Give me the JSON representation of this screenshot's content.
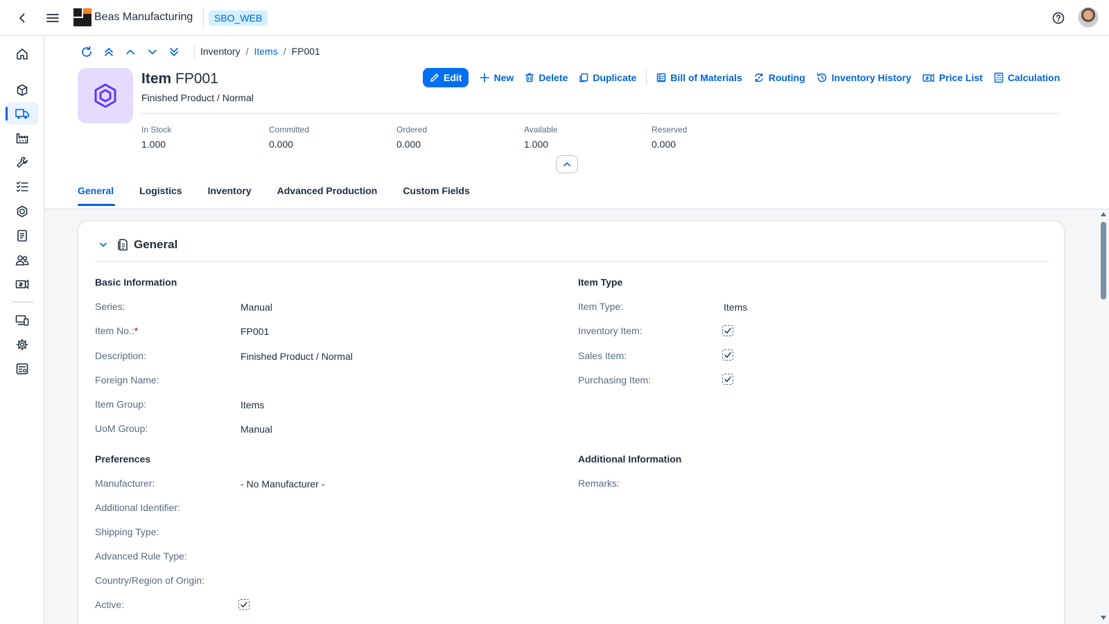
{
  "shell": {
    "brand": "Beas Manufacturing",
    "system": "SBO_WEB"
  },
  "sidenav": {
    "items": [
      "home-icon",
      "cubes-icon",
      "truck-icon",
      "factory-icon",
      "wrench-icon",
      "checklist-icon",
      "hexagon-icon",
      "document-icon",
      "people-icon",
      "pricing-icon",
      "device-icon",
      "gear-icon",
      "report-icon"
    ],
    "active": "truck-icon"
  },
  "breadcrumb": {
    "root": "Inventory",
    "parent": "Items",
    "current": "FP001",
    "separator": "/"
  },
  "header": {
    "title_bold": "Item",
    "title_id": "FP001",
    "subtitle": "Finished Product / Normal"
  },
  "actions": {
    "edit": "Edit",
    "new": "New",
    "delete": "Delete",
    "duplicate": "Duplicate",
    "bom": "Bill of Materials",
    "routing": "Routing",
    "inventory_history": "Inventory History",
    "price_list": "Price List",
    "calculation": "Calculation"
  },
  "kpis": [
    {
      "label": "In Stock",
      "value": "1.000"
    },
    {
      "label": "Committed",
      "value": "0.000"
    },
    {
      "label": "Ordered",
      "value": "0.000"
    },
    {
      "label": "Available",
      "value": "1.000"
    },
    {
      "label": "Reserved",
      "value": "0.000"
    }
  ],
  "tabs": [
    "General",
    "Logistics",
    "Inventory",
    "Advanced Production",
    "Custom Fields"
  ],
  "active_tab": "General",
  "section": {
    "title": "General",
    "basic": {
      "title": "Basic Information",
      "series_label": "Series:",
      "series_value": "Manual",
      "itemno_label": "Item No.:",
      "itemno_required": "*",
      "itemno_value": "FP001",
      "desc_label": "Description:",
      "desc_value": "Finished Product / Normal",
      "foreign_label": "Foreign Name:",
      "group_label": "Item Group:",
      "group_value": "Items",
      "uom_label": "UoM Group:",
      "uom_value": "Manual"
    },
    "itemtype": {
      "title": "Item Type",
      "type_label": "Item Type:",
      "type_value": "Items",
      "inv_label": "Inventory Item:",
      "inv_checked": true,
      "sales_label": "Sales Item:",
      "sales_checked": true,
      "purch_label": "Purchasing Item:",
      "purch_checked": true
    },
    "prefs": {
      "title": "Preferences",
      "mfr_label": "Manufacturer:",
      "mfr_value": "- No Manufacturer -",
      "addid_label": "Additional Identifier:",
      "ship_label": "Shipping Type:",
      "rule_label": "Advanced Rule Type:",
      "origin_label": "Country/Region of Origin:",
      "active_label": "Active:",
      "active_checked": true
    },
    "additional": {
      "title": "Additional Information",
      "remarks_label": "Remarks:"
    }
  },
  "colors": {
    "accent": "#0064d9",
    "primary_button": "#0070f2",
    "object_icon_bg": "#e5dbff",
    "object_icon_fg": "#5d36ff"
  }
}
